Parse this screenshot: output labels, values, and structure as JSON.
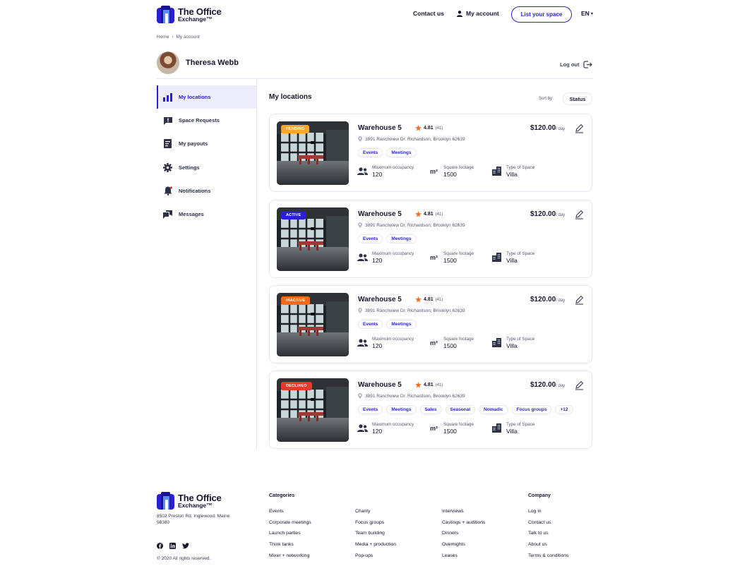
{
  "brand": {
    "line1": "The Office",
    "line2": "Exchange™"
  },
  "header": {
    "contact": "Contact us",
    "account": "My account",
    "cta": "List your space",
    "language": "EN"
  },
  "breadcrumb": {
    "home": "Home",
    "separator": "›",
    "current": "My account"
  },
  "profile": {
    "name": "Theresa Webb",
    "logout": "Log out"
  },
  "sidebar": {
    "items": [
      {
        "label": "My locations",
        "icon": "bar-chart-icon"
      },
      {
        "label": "Space Requests",
        "icon": "alert-box-icon"
      },
      {
        "label": "My payouts",
        "icon": "receipt-icon"
      },
      {
        "label": "Settings",
        "icon": "gear-icon"
      },
      {
        "label": "Notifications",
        "icon": "bell-icon"
      },
      {
        "label": "Messages",
        "icon": "chat-icon"
      }
    ]
  },
  "main": {
    "title": "My locations",
    "sort_label": "Sort by:",
    "sort_value": "Status"
  },
  "stat_labels": {
    "occupancy": "Maximum occupancy",
    "footage": "Square footage",
    "type": "Type of Space",
    "sqm": "m²"
  },
  "listings": [
    {
      "status": "PENDING",
      "status_color": "#f7a72b",
      "title": "Warehouse 5",
      "rating": "4.81",
      "reviews": "(41)",
      "address": "3891 Ranchview Dr. Richardson, Brooklyn 62639",
      "tags": [
        "Events",
        "Meetings"
      ],
      "price": "$120.00",
      "per": "/ day",
      "occupancy": "120",
      "footage": "1500",
      "space_type": "Villa"
    },
    {
      "status": "ACTIVE",
      "status_color": "#2a1fd6",
      "title": "Warehouse 5",
      "rating": "4.81",
      "reviews": "(41)",
      "address": "3891 Ranchview Dr. Richardson, Brooklyn 62639",
      "tags": [
        "Events",
        "Meetings"
      ],
      "price": "$120.00",
      "per": "/ day",
      "occupancy": "120",
      "footage": "1500",
      "space_type": "Villa"
    },
    {
      "status": "INACTIVE",
      "status_color": "#f26b1d",
      "title": "Warehouse 5",
      "rating": "4.81",
      "reviews": "(41)",
      "address": "3891 Ranchview Dr. Richardson, Brooklyn 62639",
      "tags": [
        "Events",
        "Meetings"
      ],
      "price": "$120.00",
      "per": "/ day",
      "occupancy": "120",
      "footage": "1500",
      "space_type": "Villa"
    },
    {
      "status": "DECLINED",
      "status_color": "#e43a2e",
      "title": "Warehouse 5",
      "rating": "4.81",
      "reviews": "(41)",
      "address": "3891 Ranchview Dr. Richardson, Brooklyn 62639",
      "tags": [
        "Events",
        "Meetings",
        "Sales",
        "Seasonal",
        "Nomadic",
        "Focus groups",
        "+12"
      ],
      "price": "$120.00",
      "per": "/ day",
      "occupancy": "120",
      "footage": "1500",
      "space_type": "Villa"
    }
  ],
  "footer": {
    "address": "8502 Preston Rd. Inglewood, Maine 98380",
    "copyright": "© 2020 All rights reserved.",
    "categories_title": "Categories",
    "categories": [
      [
        "Events",
        "Corporate meetings",
        "Launch parties",
        "Think tanks",
        "Mixer + networking"
      ],
      [
        "Charity",
        "Focus groups",
        "Team building",
        "Media + production",
        "Pop-ups"
      ],
      [
        "Interviews",
        "Castings + auditions",
        "Dinners",
        "Overnights",
        "Leases"
      ]
    ],
    "company_title": "Company",
    "company": [
      "Log in",
      "Contact us",
      "Talk to us",
      "About us",
      "Terms & conditions"
    ],
    "social": [
      "facebook-icon",
      "linkedin-icon",
      "twitter-icon"
    ]
  },
  "colors": {
    "accent": "#2a1fd6",
    "text": "#161630",
    "star": "#f26b1d"
  }
}
